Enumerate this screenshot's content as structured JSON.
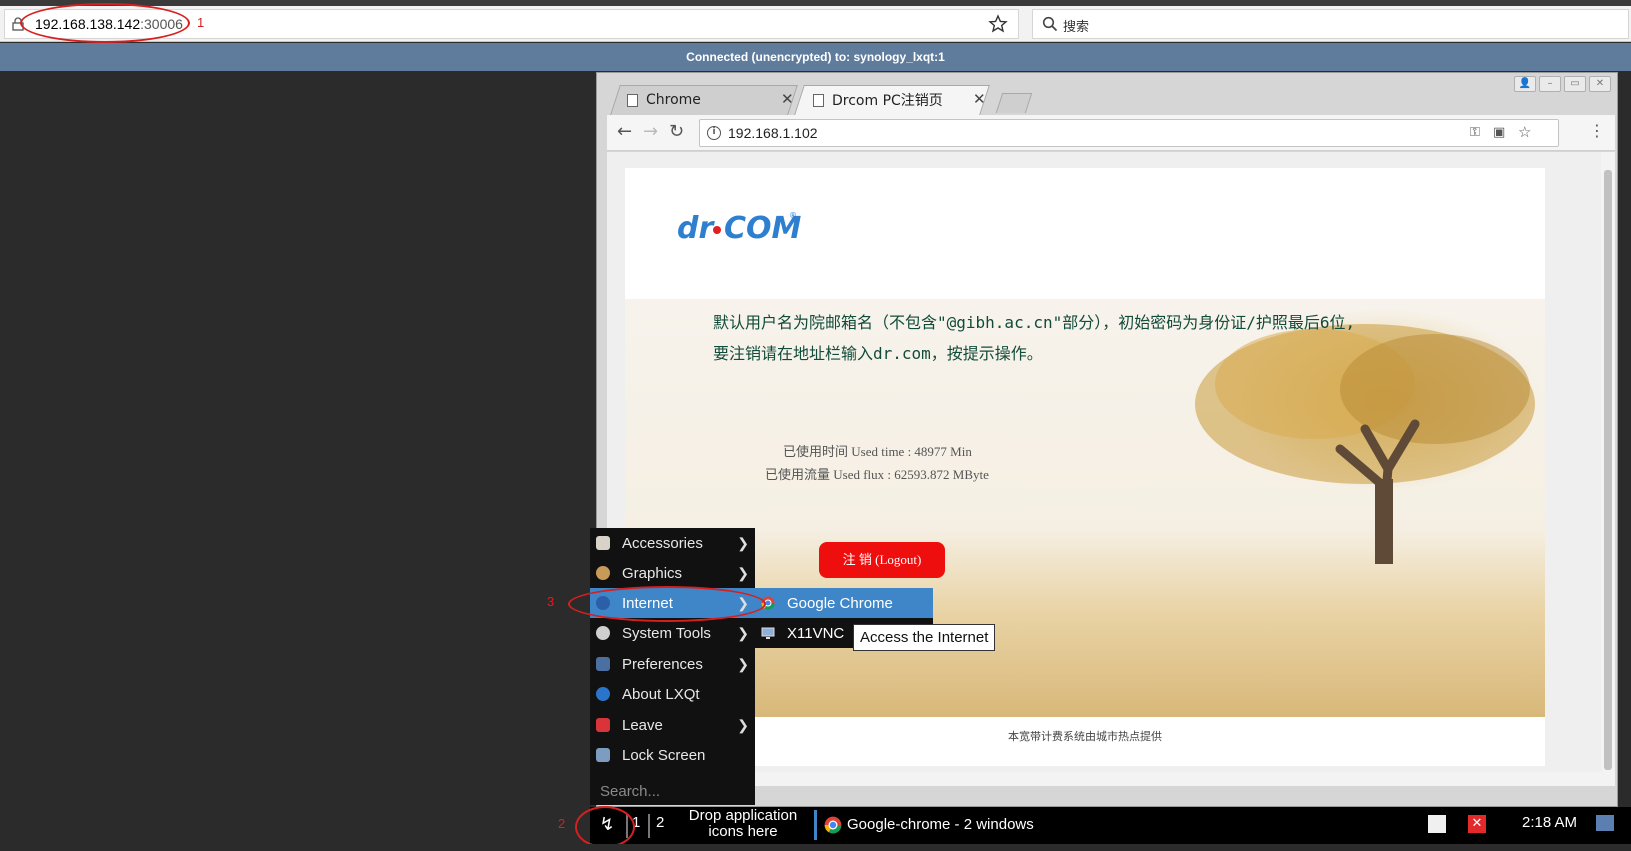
{
  "host_browser": {
    "url_host": "192.168.138.142",
    "url_port": ":30006",
    "search_placeholder": "搜索"
  },
  "annotations": [
    "1",
    "2",
    "3"
  ],
  "vnc": {
    "status": "Connected (unencrypted) to: synology_lxqt:1"
  },
  "chrome": {
    "tabs": [
      {
        "label": "Chrome"
      },
      {
        "label": "Drcom PC注销页"
      }
    ],
    "address": "192.168.1.102"
  },
  "drcom_page": {
    "notice_line1": "默认用户名为院邮箱名（不包含\"@gibh.ac.cn\"部分），初始密码为身份证/护照最后6位,",
    "notice_line2": "要注销请在地址栏输入dr.com，按提示操作。",
    "used_time": "已使用时间 Used time : 48977 Min",
    "used_flux": "已使用流量 Used flux : 62593.872 MByte",
    "logout_label": "注 销 (Logout)",
    "footer": "本宽带计费系统由城市热点提供"
  },
  "start_menu": {
    "items": [
      {
        "label": "Accessories",
        "icon": "accessories-icon",
        "arrow": true
      },
      {
        "label": "Graphics",
        "icon": "graphics-icon",
        "arrow": true
      },
      {
        "label": "Internet",
        "icon": "globe-icon",
        "arrow": true
      },
      {
        "label": "System Tools",
        "icon": "gear-icon",
        "arrow": true
      },
      {
        "label": "Preferences",
        "icon": "preferences-icon",
        "arrow": true
      },
      {
        "label": "About LXQt",
        "icon": "info-icon",
        "arrow": false
      },
      {
        "label": "Leave",
        "icon": "leave-icon",
        "arrow": true
      },
      {
        "label": "Lock Screen",
        "icon": "lock-screen-icon",
        "arrow": false
      }
    ],
    "search_placeholder": "Search...",
    "arrow_glyph": "❯"
  },
  "internet_submenu": {
    "items": [
      {
        "label": "Google Chrome",
        "icon": "chrome-icon"
      },
      {
        "label": "X11VNC",
        "icon": "monitor-icon"
      }
    ]
  },
  "tooltip": {
    "text": "Access the Internet"
  },
  "taskbar": {
    "desktops": [
      "1",
      "2"
    ],
    "drop_text": "Drop application icons here",
    "task_label": "Google-chrome - 2 windows",
    "clock": "2:18 AM"
  },
  "colors": {
    "menu_highlight": "#3e86c8",
    "logout_red": "#ee0e0e",
    "annotation_red": "#d62020",
    "vnc_bar": "#5f7c9c"
  }
}
